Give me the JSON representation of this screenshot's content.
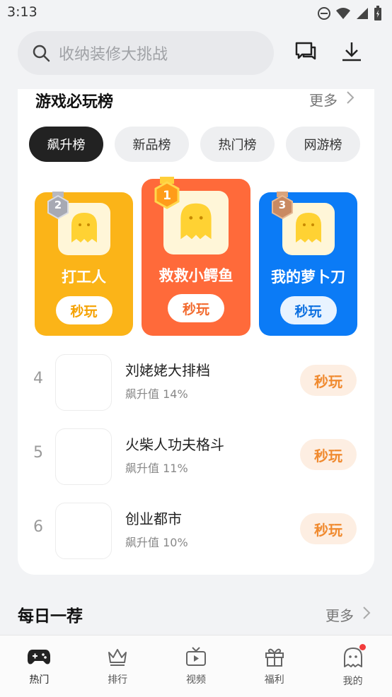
{
  "status": {
    "time": "3:13"
  },
  "search": {
    "placeholder": "收纳装修大挑战"
  },
  "section": {
    "title": "游戏必玩榜",
    "more_label": "更多"
  },
  "tabs": [
    {
      "label": "飙升榜",
      "active": true
    },
    {
      "label": "新品榜",
      "active": false
    },
    {
      "label": "热门榜",
      "active": false
    },
    {
      "label": "网游榜",
      "active": false
    }
  ],
  "podium": [
    {
      "rank": "2",
      "name": "打工人",
      "play_label": "秒玩",
      "color": "#fbb418"
    },
    {
      "rank": "1",
      "name": "救救小鳄鱼",
      "play_label": "秒玩",
      "color": "#ff6a3a"
    },
    {
      "rank": "3",
      "name": "我的萝卜刀",
      "play_label": "秒玩",
      "color": "#0b7bf6"
    }
  ],
  "list": [
    {
      "rank": "4",
      "name": "刘姥姥大排档",
      "sub": "飙升值 14%",
      "play_label": "秒玩"
    },
    {
      "rank": "5",
      "name": "火柴人功夫格斗",
      "sub": "飙升值 11%",
      "play_label": "秒玩"
    },
    {
      "rank": "6",
      "name": "创业都市",
      "sub": "飙升值 10%",
      "play_label": "秒玩"
    }
  ],
  "daily": {
    "title": "每日一荐",
    "more_label": "更多"
  },
  "nav": [
    {
      "label": "热门",
      "icon": "gamepad-icon",
      "active": true
    },
    {
      "label": "排行",
      "icon": "crown-icon",
      "active": false
    },
    {
      "label": "视频",
      "icon": "tv-icon",
      "active": false
    },
    {
      "label": "福利",
      "icon": "gift-icon",
      "active": false
    },
    {
      "label": "我的",
      "icon": "ghost-icon",
      "active": false,
      "badge": true
    }
  ],
  "colors": {
    "accent_orange": "#f08a2f",
    "badge_red": "#f23c3c"
  }
}
